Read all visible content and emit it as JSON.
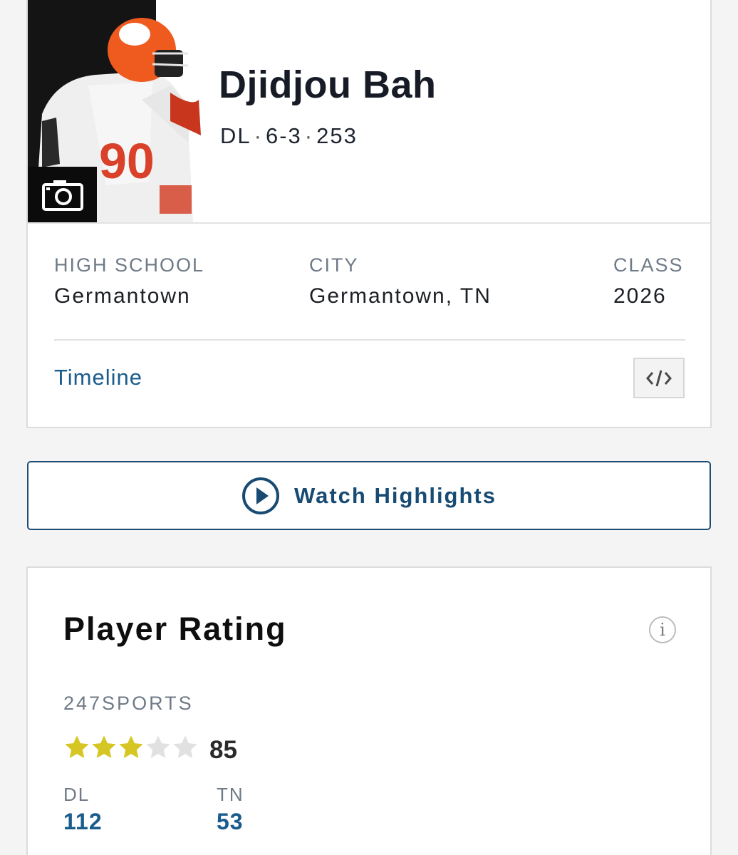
{
  "player": {
    "name": "Djidjou Bah",
    "position": "DL",
    "height": "6-3",
    "weight": "253"
  },
  "info": {
    "high_school_label": "HIGH SCHOOL",
    "high_school": "Germantown",
    "city_label": "CITY",
    "city": "Germantown, TN",
    "class_label": "CLASS",
    "class": "2026"
  },
  "links": {
    "timeline": "Timeline"
  },
  "highlights": {
    "label": "Watch Highlights"
  },
  "rating": {
    "title": "Player Rating",
    "source": "247SPORTS",
    "stars": 3,
    "max_stars": 5,
    "score": "85",
    "position_rank_label": "DL",
    "position_rank": "112",
    "state_rank_label": "TN",
    "state_rank": "53"
  },
  "colors": {
    "link": "#1a5c8c",
    "star_filled": "#d6c624",
    "star_empty": "#e1e1e1"
  },
  "icons": {
    "photo": "camera-icon",
    "embed": "code-icon",
    "highlights": "play-circle-icon",
    "rating_info": "info-icon"
  }
}
